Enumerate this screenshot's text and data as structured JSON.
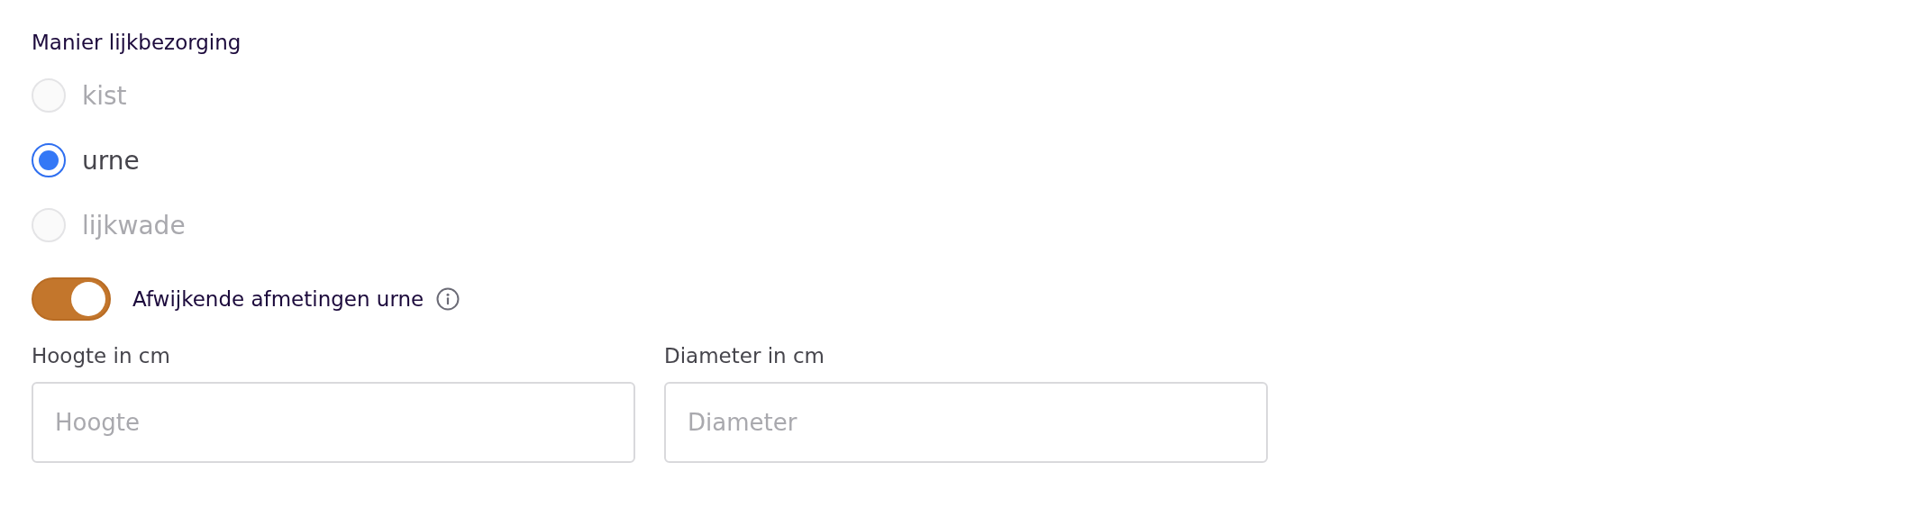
{
  "group_label": "Manier lijkbezorging",
  "options": [
    {
      "label": "kist",
      "selected": false,
      "disabled": true
    },
    {
      "label": "urne",
      "selected": true,
      "disabled": false
    },
    {
      "label": "lijkwade",
      "selected": false,
      "disabled": true
    }
  ],
  "toggle": {
    "label": "Afwijkende afmetingen urne",
    "on": true
  },
  "fields": [
    {
      "label": "Hoogte in cm",
      "placeholder": "Hoogte"
    },
    {
      "label": "Diameter in cm",
      "placeholder": "Diameter"
    }
  ]
}
